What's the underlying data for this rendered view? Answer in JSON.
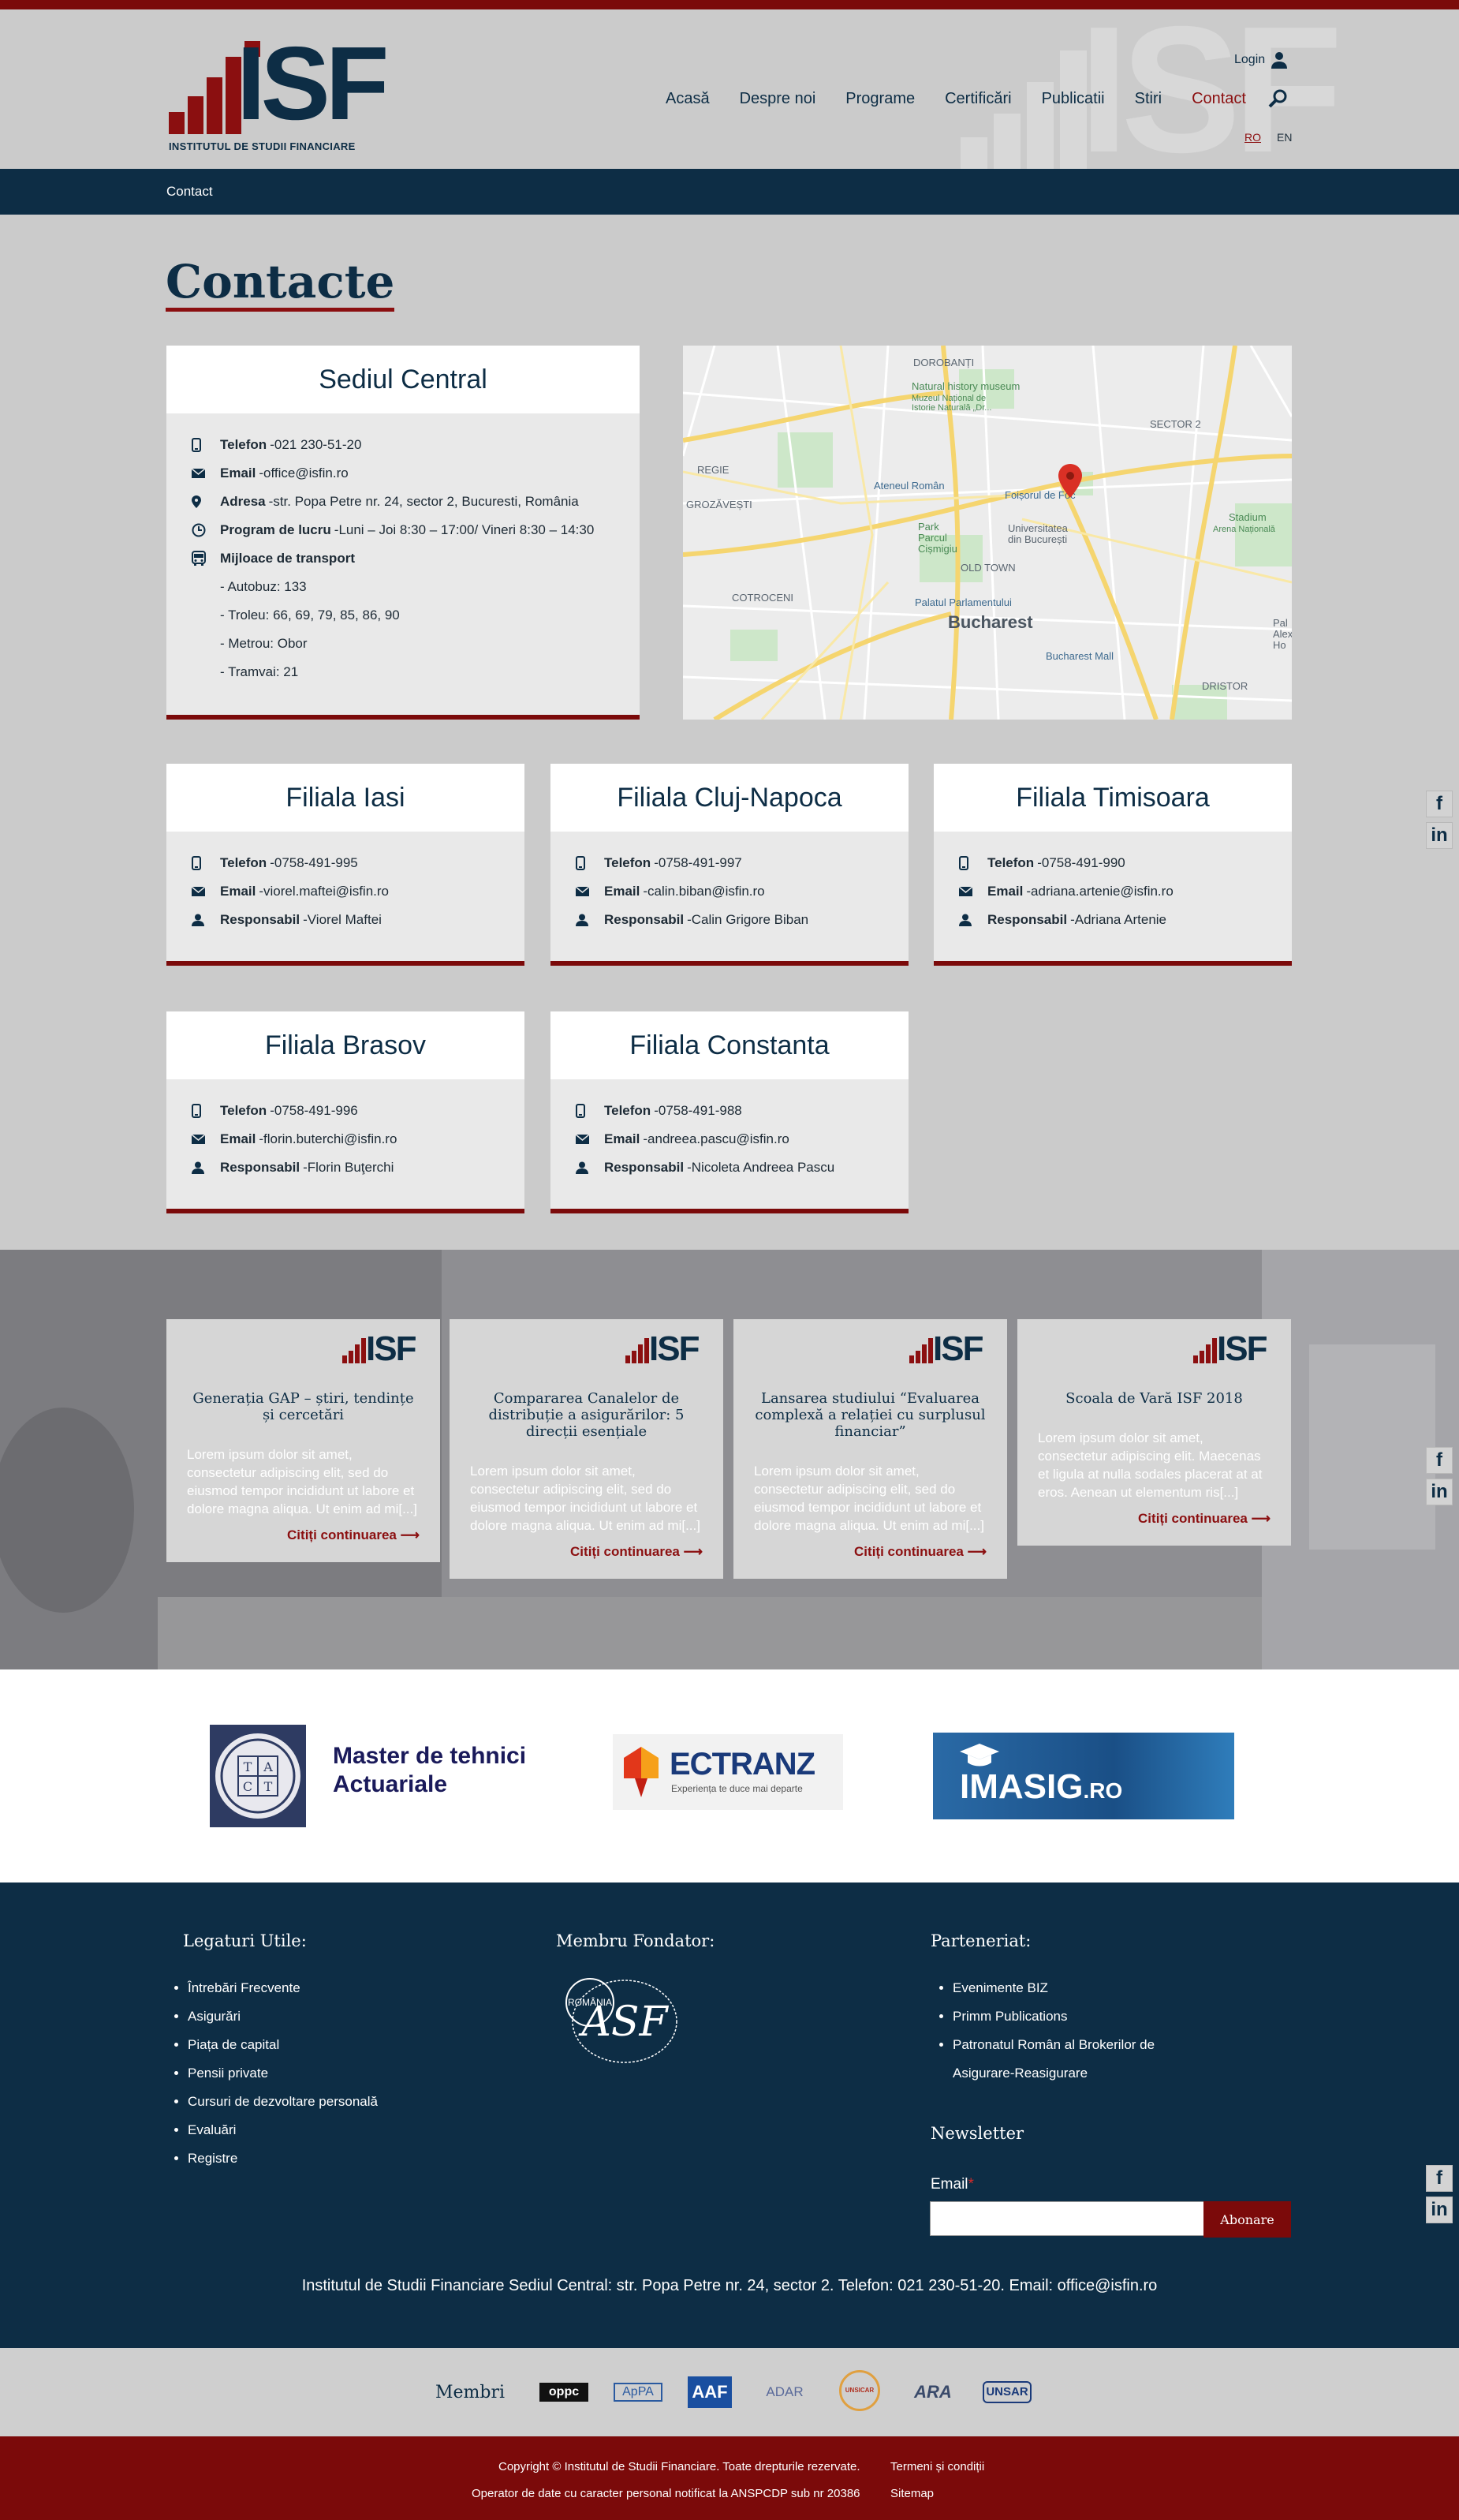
{
  "header": {
    "logo_text": "ISF",
    "logo_subtitle": "INSTITUTUL DE STUDII FINANCIARE",
    "login_label": "Login",
    "nav": [
      "Acasă",
      "Despre noi",
      "Programe",
      "Certificări",
      "Publicatii",
      "Stiri",
      "Contact"
    ],
    "active_nav": "Contact",
    "lang": [
      "RO",
      "EN"
    ]
  },
  "breadcrumb": "Contact",
  "page_title": "Contacte",
  "sediu": {
    "title": "Sediul Central",
    "telefon_label": "Telefon",
    "telefon": "021 230-51-20",
    "email_label": "Email",
    "email": "office@isfin.ro",
    "adresa_label": "Adresa",
    "adresa": "str. Popa Petre nr. 24, sector 2, Bucuresti, România",
    "program_label": "Program de lucru",
    "program": "Luni – Joi 8:30 – 17:00/ Vineri 8:30 – 14:30",
    "transport_label": "Mijloace de transport",
    "transport": [
      "- Autobuz: 133",
      "- Troleu: 66, 69, 79, 85, 86, 90",
      "- Metrou: Obor",
      "- Tramvai: 21"
    ]
  },
  "map": {
    "labels": [
      "DOROBANȚI",
      "Natural history museum",
      "Muzeul Național de",
      "Istorie Naturală „Dr...",
      "SECTOR 2",
      "REGIE",
      "Ateneul Român",
      "GROZĂVEȘTI",
      "Foișorul de Foc",
      "Universitatea",
      "din București",
      "Park",
      "Parcul",
      "Cișmigiu",
      "Stadium",
      "Arena Națională",
      "OLD TOWN",
      "COTROCENI",
      "Palatul Parlamentului",
      "Bucharest",
      "Bucharest Mall",
      "DRISTOR",
      "Pal",
      "Alex",
      "Ho"
    ]
  },
  "branches": [
    {
      "title": "Filiala Iasi",
      "telefon": "0758-491-995",
      "email": "viorel.maftei@isfin.ro",
      "resp": "Viorel Maftei"
    },
    {
      "title": "Filiala Cluj-Napoca",
      "telefon": "0758-491-997",
      "email": "calin.biban@isfin.ro",
      "resp": "Calin Grigore Biban"
    },
    {
      "title": "Filiala Timisoara",
      "telefon": "0758-491-990",
      "email": "adriana.artenie@isfin.ro",
      "resp": "Adriana Artenie"
    },
    {
      "title": "Filiala Brasov",
      "telefon": "0758-491-996",
      "email": "florin.buterchi@isfin.ro",
      "resp": "Florin Buţerchi"
    },
    {
      "title": "Filiala Constanta",
      "telefon": "0758-491-988",
      "email": "andreea.pascu@isfin.ro",
      "resp": "Nicoleta Andreea Pascu"
    }
  ],
  "labels": {
    "telefon": "Telefon",
    "email": "Email",
    "resp": "Responsabil"
  },
  "news": [
    {
      "title": "Generația GAP – știri, tendințe și cercetări",
      "text": "Lorem ipsum dolor sit amet, consectetur adipiscing elit, sed do eiusmod tempor incididunt ut labore et dolore magna aliqua. Ut enim ad mi[...]",
      "more": "Citiți continuarea"
    },
    {
      "title": "Compararea Canalelor de distribuție a asigurărilor: 5 direcții esențiale",
      "text": "Lorem ipsum dolor sit amet, consectetur adipiscing elit, sed do eiusmod tempor incididunt ut labore et dolore magna aliqua. Ut enim ad mi[...]",
      "more": "Citiți continuarea"
    },
    {
      "title": "Lansarea studiului “Evaluarea complexă a relației cu surplusul financiar”",
      "text": "Lorem ipsum dolor sit amet, consectetur adipiscing elit, sed do eiusmod tempor incididunt ut labore et dolore magna aliqua. Ut enim ad mi[...]",
      "more": "Citiți continuarea"
    },
    {
      "title": "Scoala de Vară ISF 2018",
      "text": "Lorem ipsum dolor sit amet, consectetur adipiscing elit. Maecenas et ligula at nulla sodales placerat at at eros. Aenean ut elementum ris[...]",
      "more": "Citiți continuarea"
    }
  ],
  "partners": {
    "master": "Master de tehnici Actuariale",
    "tact": [
      "T",
      "A",
      "C",
      "T"
    ],
    "ectranz": "ECTRANZ",
    "ectranz_tag": "Experiența te duce mai departe",
    "imasig": "IMASIG",
    "imasig_suffix": ".RO"
  },
  "footer": {
    "legaturi_title": "Legaturi Utile:",
    "legaturi": [
      "Întrebări Frecvente",
      "Asigurări",
      "Piața de capital",
      "Pensii private",
      "Cursuri de dezvoltare personală",
      "Evaluări",
      "Registre"
    ],
    "membru_title": "Membru Fondator:",
    "asf_text": "ROMÂNIA",
    "parteneriat_title": "Parteneriat:",
    "parteneriat": [
      "Evenimente BIZ",
      "Primm Publications",
      "Patronatul Român al Brokerilor de Asigurare-Reasigurare"
    ],
    "newsletter_title": "Newsletter",
    "email_label": "Email",
    "subscribe": "Abonare",
    "address": "Institutul de Studii Financiare Sediul Central: str. Popa Petre nr. 24, sector 2. Telefon: 021 230-51-20. Email: office@isfin.ro"
  },
  "membri": {
    "label": "Membri",
    "logos": [
      "oppc",
      "ApPA",
      "AAF",
      "ADAR",
      "UNSICAR",
      "ARA",
      "UNSAR"
    ]
  },
  "copyright": {
    "line1": "Copyright © Institutul de Studii Financiare. Toate drepturile rezervate.",
    "line2": "Operator de date cu caracter personal notificat la ANSPCDP sub nr 20386",
    "termeni": "Termeni și condiții",
    "sitemap": "Sitemap"
  },
  "colors": {
    "navy": "#0d2d45",
    "brand_red": "#8b0f10",
    "bg_gray": "#cbcbcb"
  }
}
